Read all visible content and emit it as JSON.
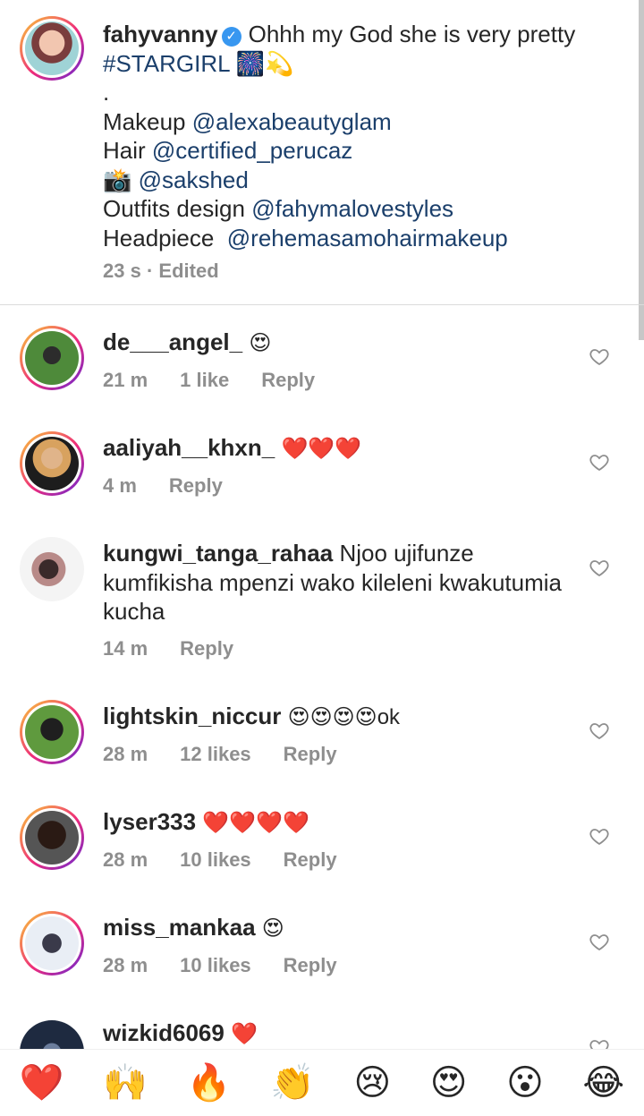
{
  "caption": {
    "username": "fahyvanny",
    "verified_icon": "verified-badge-icon",
    "text_first": "Ohhh my God she is very pretty",
    "hashtag": "#STARGIRL",
    "hashtag_emojis": "🎆💫",
    "dot": ".",
    "makeup_label": "Makeup",
    "makeup_mention": "@alexabeautyglam",
    "hair_label": "Hair",
    "hair_mention": "@certified_perucaz",
    "camera_emoji": "📸",
    "camera_mention": "@sakshed",
    "outfits_label": "Outfits design",
    "outfits_mention": "@fahymalovestyles",
    "headpiece_label": "Headpiece",
    "headpiece_mention": "@rehemasamohairmakeup",
    "time": "23 s",
    "sep": "·",
    "edited": "Edited"
  },
  "comments": [
    {
      "username": "de___angel_",
      "text": "😍",
      "time": "21 m",
      "likes": "1 like",
      "reply": "Reply"
    },
    {
      "username": "aaliyah__khxn_",
      "text": "❤️❤️❤️",
      "time": "4 m",
      "likes": "",
      "reply": "Reply"
    },
    {
      "username": "kungwi_tanga_rahaa",
      "text": "Njoo ujifunze kumfikisha mpenzi wako kileleni kwakutumia kucha",
      "time": "14 m",
      "likes": "",
      "reply": "Reply"
    },
    {
      "username": "lightskin_niccur",
      "text": "😍😍😍😍ok",
      "time": "28 m",
      "likes": "12 likes",
      "reply": "Reply"
    },
    {
      "username": "lyser333",
      "text": "❤️❤️❤️❤️",
      "time": "28 m",
      "likes": "10 likes",
      "reply": "Reply"
    },
    {
      "username": "miss_mankaa",
      "text": "😍",
      "time": "28 m",
      "likes": "10 likes",
      "reply": "Reply"
    },
    {
      "username": "wizkid6069",
      "text": "❤️",
      "time": "",
      "likes": "",
      "reply": ""
    }
  ],
  "reactions": [
    "❤️",
    "🙌",
    "🔥",
    "👏",
    "😢",
    "😍",
    "😮",
    "😂"
  ],
  "colors": {
    "mention": "#1b3f6b",
    "meta": "#8e8e8e",
    "verified": "#3897f0"
  }
}
